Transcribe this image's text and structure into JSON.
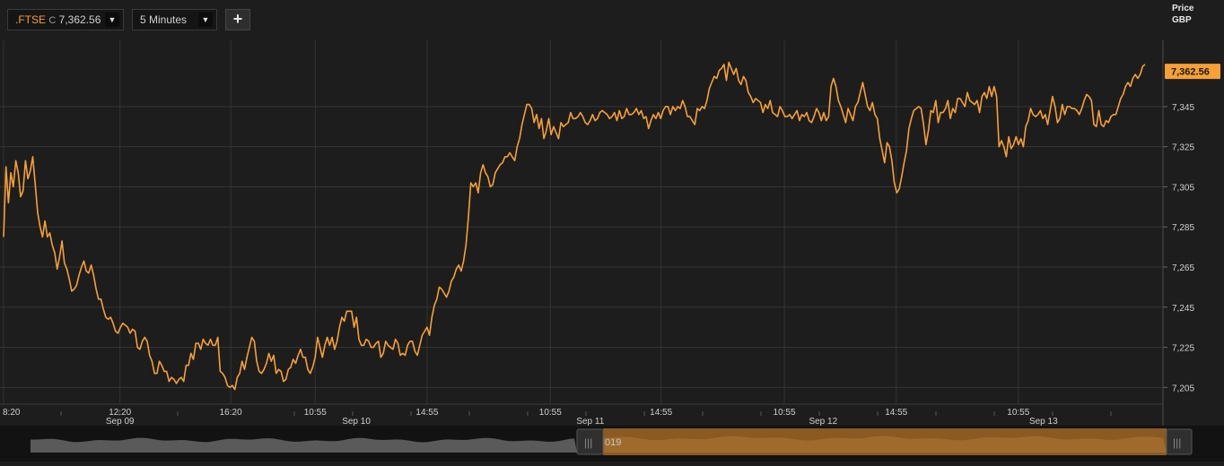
{
  "toolbar": {
    "symbol": ".FTSE",
    "quote_prefix": "C",
    "quote_value": "7,362.56",
    "interval": "5 Minutes",
    "add_label": "+"
  },
  "axis_header": {
    "line1": "Price",
    "line2": "GBP"
  },
  "last_price_label": "7,362.56",
  "navigator": {
    "visible_text": "019"
  },
  "colors": {
    "line": "#f7a035",
    "background": "#1d1d1d",
    "grid": "#343434",
    "last_price_bg": "#f7a035",
    "navigator_selection": "#8a5a22"
  },
  "chart_data": {
    "type": "line",
    "title": "",
    "series": [
      {
        "name": ".FTSE",
        "values": [
          7280,
          7315,
          7297,
          7312,
          7305,
          7318,
          7312,
          7300,
          7303,
          7318,
          7309,
          7313,
          7320,
          7306,
          7292,
          7285,
          7280,
          7288,
          7280,
          7282,
          7276,
          7272,
          7264,
          7270,
          7278,
          7267,
          7264,
          7259,
          7253,
          7254,
          7256,
          7261,
          7265,
          7268,
          7263,
          7262,
          7266,
          7261,
          7254,
          7249,
          7249,
          7244,
          7240,
          7239,
          7240,
          7237,
          7233,
          7232,
          7235,
          7237,
          7236,
          7235,
          7232,
          7234,
          7233,
          7225,
          7224,
          7228,
          7230,
          7228,
          7221,
          7218,
          7212,
          7212,
          7218,
          7216,
          7213,
          7213,
          7208,
          7210,
          7209,
          7207,
          7209,
          7210,
          7208,
          7216,
          7216,
          7222,
          7219,
          7227,
          7227,
          7224,
          7229,
          7227,
          7226,
          7229,
          7226,
          7226,
          7230,
          7213,
          7212,
          7210,
          7206,
          7205,
          7206,
          7204,
          7210,
          7212,
          7218,
          7214,
          7220,
          7225,
          7230,
          7228,
          7218,
          7213,
          7212,
          7214,
          7217,
          7222,
          7218,
          7221,
          7212,
          7214,
          7213,
          7208,
          7209,
          7214,
          7215,
          7219,
          7217,
          7221,
          7224,
          7220,
          7220,
          7214,
          7212,
          7215,
          7220,
          7230,
          7225,
          7220,
          7226,
          7230,
          7226,
          7230,
          7224,
          7228,
          7235,
          7240,
          7238,
          7243,
          7243,
          7243,
          7235,
          7240,
          7229,
          7226,
          7226,
          7229,
          7228,
          7225,
          7225,
          7227,
          7228,
          7220,
          7222,
          7228,
          7226,
          7225,
          7224,
          7229,
          7227,
          7221,
          7222,
          7221,
          7226,
          7228,
          7228,
          7223,
          7221,
          7226,
          7231,
          7233,
          7235,
          7231,
          7240,
          7246,
          7249,
          7255,
          7254,
          7252,
          7250,
          7253,
          7258,
          7260,
          7264,
          7266,
          7263,
          7268,
          7276,
          7290,
          7307,
          7305,
          7307,
          7302,
          7312,
          7316,
          7312,
          7310,
          7305,
          7306,
          7312,
          7314,
          7316,
          7317,
          7320,
          7320,
          7322,
          7320,
          7318,
          7325,
          7329,
          7336,
          7341,
          7346,
          7346,
          7344,
          7337,
          7341,
          7334,
          7339,
          7329,
          7333,
          7339,
          7331,
          7335,
          7332,
          7329,
          7337,
          7335,
          7336,
          7337,
          7342,
          7339,
          7339,
          7340,
          7342,
          7340,
          7337,
          7336,
          7338,
          7341,
          7338,
          7339,
          7342,
          7343,
          7342,
          7341,
          7339,
          7340,
          7342,
          7338,
          7343,
          7339,
          7340,
          7344,
          7341,
          7341,
          7342,
          7344,
          7341,
          7343,
          7339,
          7340,
          7334,
          7338,
          7341,
          7339,
          7342,
          7339,
          7343,
          7345,
          7345,
          7341,
          7345,
          7343,
          7345,
          7344,
          7348,
          7345,
          7340,
          7340,
          7338,
          7336,
          7344,
          7343,
          7345,
          7344,
          7348,
          7354,
          7357,
          7360,
          7359,
          7363,
          7364,
          7366,
          7358,
          7367,
          7364,
          7361,
          7364,
          7358,
          7356,
          7360,
          7358,
          7352,
          7350,
          7347,
          7349,
          7348,
          7347,
          7342,
          7346,
          7344,
          7348,
          7342,
          7341,
          7340,
          7345,
          7343,
          7340,
          7340,
          7341,
          7339,
          7341,
          7343,
          7338,
          7341,
          7340,
          7342,
          7338,
          7337,
          7340,
          7344,
          7342,
          7338,
          7342,
          7338,
          7340,
          7355,
          7359,
          7355,
          7348,
          7345,
          7341,
          7337,
          7344,
          7341,
          7338,
          7345,
          7347,
          7352,
          7357,
          7351,
          7345,
          7343,
          7347,
          7341,
          7339,
          7329,
          7323,
          7317,
          7327,
          7325,
          7318,
          7307,
          7302,
          7304,
          7310,
          7317,
          7323,
          7334,
          7339,
          7343,
          7344,
          7345,
          7344,
          7336,
          7326,
          7333,
          7343,
          7342,
          7348,
          7337,
          7342,
          7342,
          7344,
          7348,
          7339,
          7344,
          7342,
          7349,
          7349,
          7347,
          7345,
          7352,
          7348,
          7347,
          7346,
          7348,
          7342,
          7350,
          7352,
          7349,
          7355,
          7350,
          7355,
          7350,
          7325,
          7328,
          7325,
          7320,
          7330,
          7324,
          7326,
          7330,
          7326,
          7329,
          7325,
          7335,
          7338,
          7344,
          7341,
          7340,
          7341,
          7343,
          7339,
          7341,
          7336,
          7343,
          7350,
          7345,
          7337,
          7339,
          7346,
          7341,
          7345,
          7345,
          7344,
          7344,
          7343,
          7341,
          7344,
          7348,
          7351,
          7350,
          7348,
          7336,
          7335,
          7343,
          7336,
          7335,
          7338,
          7337,
          7340,
          7341,
          7341,
          7345,
          7349,
          7351,
          7355,
          7357,
          7355,
          7359,
          7361,
          7359,
          7361,
          7365,
          7366
        ]
      }
    ],
    "y_ticks": [
      7205,
      7225,
      7245,
      7265,
      7285,
      7305,
      7325,
      7345
    ],
    "y_tick_labels": [
      "7,205",
      "7,225",
      "7,245",
      "7,265",
      "7,285",
      "7,305",
      "7,325",
      "7,345"
    ],
    "ylim": [
      7198,
      7378
    ],
    "x_time_ticks": [
      {
        "label": "8:20",
        "frac": 0.0
      },
      {
        "label": "12:20",
        "frac": 0.102
      },
      {
        "label": "16:20",
        "frac": 0.199
      },
      {
        "label": "10:55",
        "frac": 0.273
      },
      {
        "label": "14:55",
        "frac": 0.371
      },
      {
        "label": "10:55",
        "frac": 0.479
      },
      {
        "label": "14:55",
        "frac": 0.576
      },
      {
        "label": "10:55",
        "frac": 0.684
      },
      {
        "label": "14:55",
        "frac": 0.782
      },
      {
        "label": "10:55",
        "frac": 0.889
      }
    ],
    "x_date_ticks": [
      {
        "label": "Sep 09",
        "frac": 0.102
      },
      {
        "label": "Sep 10",
        "frac": 0.309
      },
      {
        "label": "Sep 11",
        "frac": 0.514
      },
      {
        "label": "Sep 12",
        "frac": 0.718
      },
      {
        "label": "Sep 13",
        "frac": 0.911
      }
    ],
    "last_value": 7362.56,
    "grid": true
  }
}
